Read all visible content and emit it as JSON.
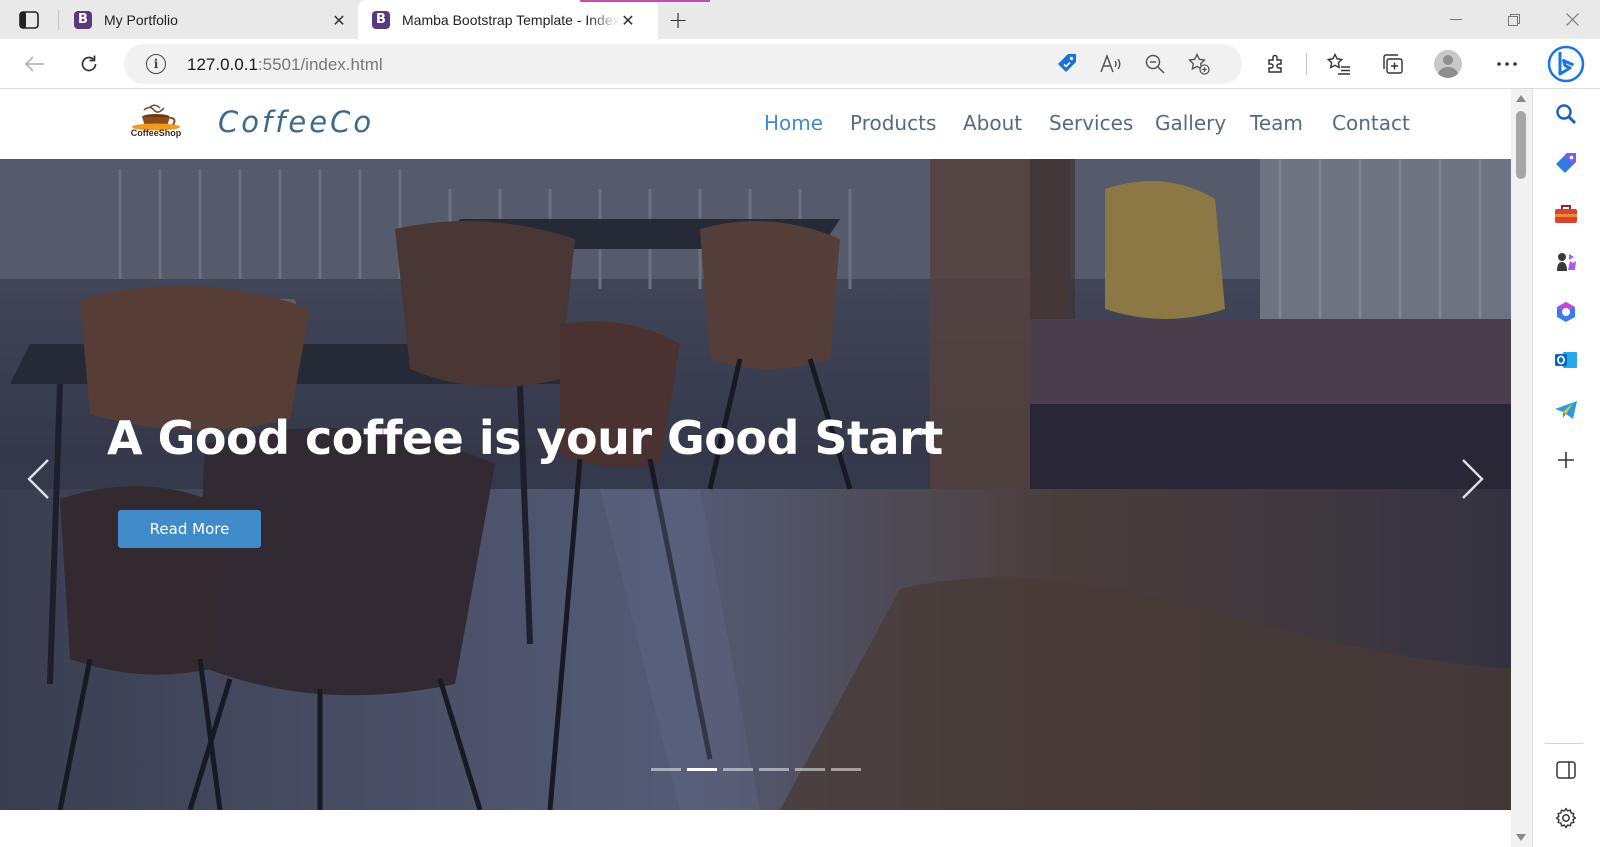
{
  "browser": {
    "tabs": [
      {
        "title": "My Portfolio",
        "favicon": "B",
        "active": false
      },
      {
        "title": "Mamba Bootstrap Template - Index",
        "favicon": "B",
        "active": true
      }
    ],
    "address": {
      "host": "127.0.0.1",
      "path": ":5501/index.html"
    },
    "accent_color": "#c44bb0",
    "sidebar_icons": [
      "search-icon",
      "shopping-tag-icon",
      "tools-briefcase-icon",
      "games-icon",
      "office-icon",
      "outlook-icon",
      "telegram-icon",
      "add-icon"
    ]
  },
  "site": {
    "brand": "CoffeeCo",
    "logo_text": "CoffeeShop",
    "nav": [
      {
        "label": "Home",
        "active": true
      },
      {
        "label": "Products",
        "active": false
      },
      {
        "label": "About",
        "active": false
      },
      {
        "label": "Services",
        "active": false
      },
      {
        "label": "Gallery",
        "active": false
      },
      {
        "label": "Team",
        "active": false
      },
      {
        "label": "Contact",
        "active": false
      }
    ],
    "hero": {
      "title": "A Good coffee is your Good Start",
      "button_label": "Read More",
      "slides_total": 6,
      "active_slide": 2
    },
    "colors": {
      "primary": "#428bca",
      "nav_text": "#556b7f",
      "brand_text": "#3b6a8e"
    }
  }
}
